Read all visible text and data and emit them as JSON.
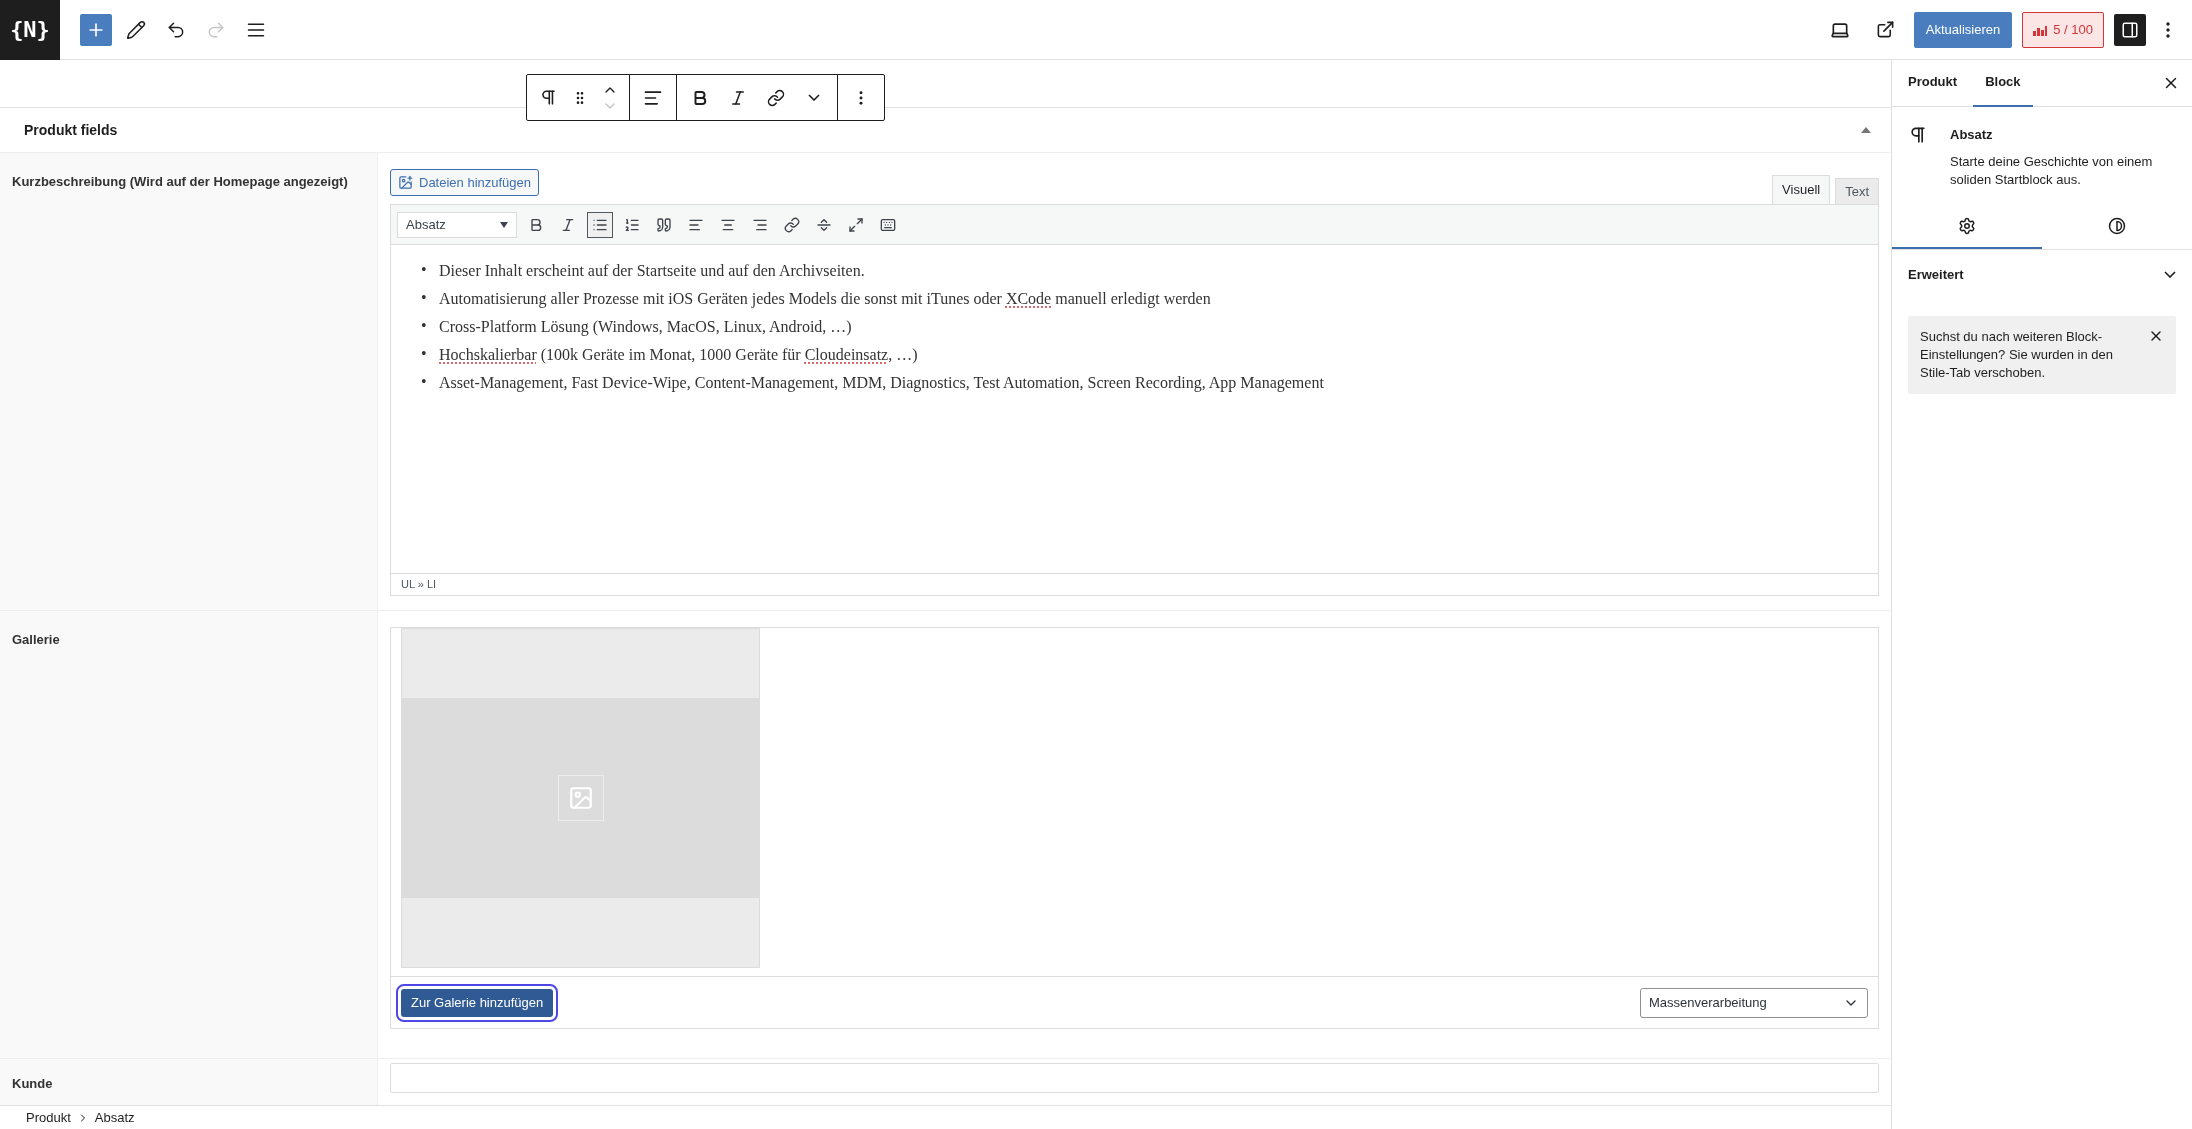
{
  "top_bar": {
    "logo": "{N}",
    "tools": [
      {
        "kind": "add",
        "disabled": false
      },
      {
        "kind": "edit",
        "disabled": false
      },
      {
        "kind": "undo",
        "disabled": false
      },
      {
        "kind": "redo",
        "disabled": true
      },
      {
        "kind": "outline",
        "disabled": false
      }
    ],
    "update_button": "Aktualisieren",
    "score_badge": "5 / 100"
  },
  "panel": {
    "title": "Produkt fields",
    "expanded": true
  },
  "fields": [
    {
      "kind": "wysiwyg",
      "label": "Kurzbeschreibung (Wird auf der Homepage angezeigt)",
      "media_button": "Dateien hinzufügen",
      "tabs": [
        {
          "label": "Visuell",
          "selected": true
        },
        {
          "label": "Text",
          "selected": false
        }
      ],
      "format_select": "Absatz",
      "format_tools": [
        {
          "kind": "bold",
          "active": false
        },
        {
          "kind": "italic",
          "active": false
        },
        {
          "kind": "bullets",
          "active": true
        },
        {
          "kind": "numbers",
          "active": false
        },
        {
          "kind": "quote",
          "active": false
        },
        {
          "kind": "align-left",
          "active": false
        },
        {
          "kind": "align-center",
          "active": false
        },
        {
          "kind": "align-right",
          "active": false
        },
        {
          "kind": "link",
          "active": false
        },
        {
          "kind": "more",
          "active": false
        },
        {
          "kind": "fullscreen",
          "active": false
        },
        {
          "kind": "keyboard",
          "active": false
        }
      ],
      "list_items": [
        {
          "marker": "•",
          "segments": [
            {
              "text": "Dieser Inhalt erscheint auf der Startseite und auf den Archivseiten.",
              "misspelled": false
            }
          ]
        },
        {
          "marker": "•",
          "segments": [
            {
              "text": "Automatisierung aller Prozesse mit iOS Geräten jedes Models die sonst mit iTunes oder ",
              "misspelled": false
            },
            {
              "text": "XCode",
              "misspelled": true
            },
            {
              "text": " manuell erledigt werden",
              "misspelled": false
            }
          ]
        },
        {
          "marker": "•",
          "segments": [
            {
              "text": "Cross-Platform Lösung (Windows, MacOS, Linux, Android, …)",
              "misspelled": false
            }
          ]
        },
        {
          "marker": "•",
          "segments": [
            {
              "text": "Hochskalierbar",
              "misspelled": true
            },
            {
              "text": " (100k Geräte im Monat, 1000 Geräte für ",
              "misspelled": false
            },
            {
              "text": "Cloudeinsatz",
              "misspelled": true
            },
            {
              "text": ", …)",
              "misspelled": false
            }
          ]
        },
        {
          "marker": "•",
          "segments": [
            {
              "text": "Asset-Management, Fast Device-Wipe, Content-Management, MDM, Diagnostics, Test Automation, Screen Recording, App Management",
              "misspelled": false
            }
          ]
        }
      ],
      "path": "UL » LI"
    },
    {
      "kind": "gallery",
      "label": "Gallerie",
      "add_button": "Zur Galerie hinzufügen",
      "bulk_select": "Massenverarbeitung"
    },
    {
      "kind": "text",
      "label": "Kunde"
    }
  ],
  "sidebar": {
    "tabs": [
      {
        "label": "Produkt",
        "selected": false
      },
      {
        "label": "Block",
        "selected": true
      }
    ],
    "block": {
      "title": "Absatz",
      "description": "Starte deine Geschichte von einem soliden Startblock aus."
    },
    "inspector_tabs": [
      {
        "kind": "settings",
        "selected": true
      },
      {
        "kind": "styles",
        "selected": false
      }
    ],
    "section": {
      "title": "Erweitert",
      "expanded": false
    },
    "notice": "Suchst du nach weiteren Block-Einstellungen? Sie wurden in den Stile-Tab verschoben."
  },
  "breadcrumb": [
    "Produkt",
    "Absatz"
  ]
}
